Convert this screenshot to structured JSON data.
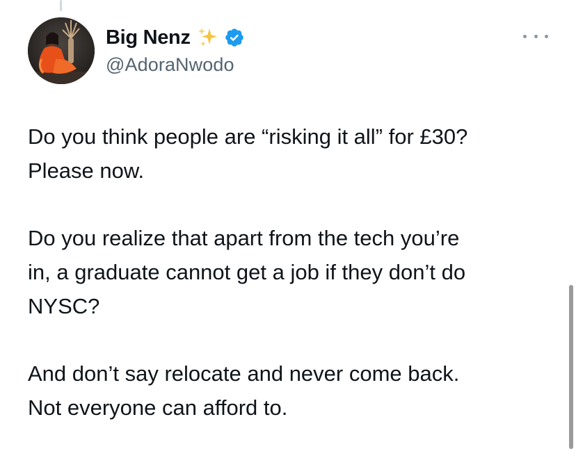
{
  "tweet": {
    "author": {
      "display_name": "Big Nenz",
      "handle": "@AdoraNwodo",
      "emoji_icon": "sparkles-icon",
      "verified_icon": "verified-badge-icon",
      "verified_color": "#1d9bf0"
    },
    "more_icon": "more-options-icon",
    "paragraphs": [
      "Do you think people are “risking it all” for £30?\nPlease now.",
      "Do you realize that apart from the tech you’re\nin, a graduate cannot get a job if they don’t do\nNYSC?",
      "And don’t say relocate and never come back.\nNot everyone can afford to."
    ]
  },
  "colors": {
    "text_primary": "#0f1419",
    "text_secondary": "#536471",
    "background": "#ffffff"
  }
}
